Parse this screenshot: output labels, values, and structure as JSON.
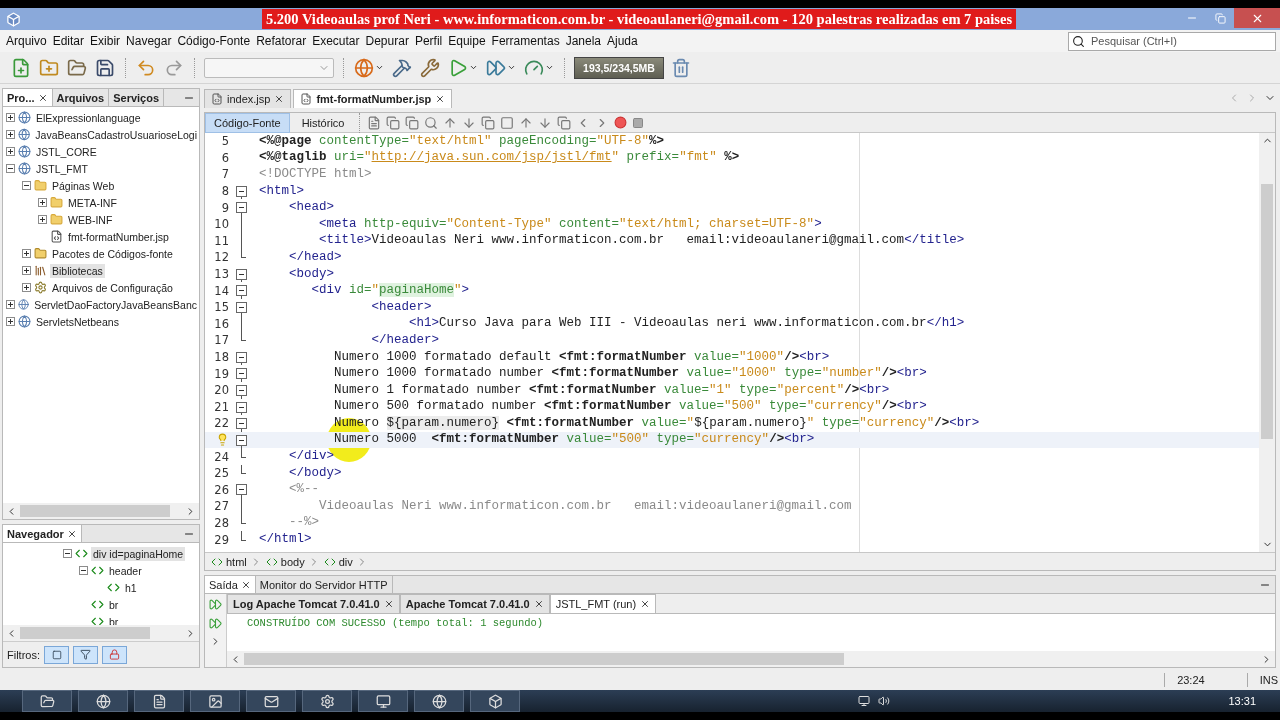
{
  "window": {
    "banner": "5.200 Videoaulas prof Neri - www.informaticon.com.br - videoaulaneri@gmail.com - 120 palestras realizadas em 7 paises"
  },
  "menu": [
    "Arquivo",
    "Editar",
    "Exibir",
    "Navegar",
    "Código-Fonte",
    "Refatorar",
    "Executar",
    "Depurar",
    "Perfil",
    "Equipe",
    "Ferramentas",
    "Janela",
    "Ajuda"
  ],
  "search": {
    "placeholder": "Pesquisar (Ctrl+I)"
  },
  "toolbar": {
    "memory": "193,5/234,5MB"
  },
  "projects_panel": {
    "tabs": [
      {
        "label": "Pro...",
        "selected": true,
        "closable": true
      },
      {
        "label": "Arquivos",
        "selected": false,
        "closable": false
      },
      {
        "label": "Serviços",
        "selected": false,
        "closable": false
      }
    ],
    "tree": [
      {
        "label": "ElExpressionlanguage",
        "kind": "project",
        "expanded": false,
        "selected": false
      },
      {
        "label": "JavaBeansCadastroUsuarioseLogi",
        "kind": "project",
        "expanded": false,
        "selected": false
      },
      {
        "label": "JSTL_CORE",
        "kind": "project",
        "expanded": false,
        "selected": false
      },
      {
        "label": "JSTL_FMT",
        "kind": "project",
        "expanded": true,
        "selected": false,
        "children": [
          {
            "label": "Páginas Web",
            "kind": "web-folder",
            "expanded": true,
            "selected": false,
            "children": [
              {
                "label": "META-INF",
                "kind": "folder",
                "expanded": false,
                "selected": false
              },
              {
                "label": "WEB-INF",
                "kind": "folder",
                "expanded": false,
                "selected": false
              },
              {
                "label": "fmt-formatNumber.jsp",
                "kind": "file",
                "selected": false
              }
            ]
          },
          {
            "label": "Pacotes de Códigos-fonte",
            "kind": "source-folder",
            "expanded": false,
            "selected": false
          },
          {
            "label": "Bibliotecas",
            "kind": "library",
            "expanded": false,
            "selected": true
          },
          {
            "label": "Arquivos de Configuração",
            "kind": "config",
            "expanded": false,
            "selected": false
          }
        ]
      },
      {
        "label": "ServletDaoFactoryJavaBeansBanc",
        "kind": "project",
        "expanded": false,
        "selected": false
      },
      {
        "label": "ServletsNetbeans",
        "kind": "project",
        "expanded": false,
        "selected": false
      }
    ]
  },
  "navigator": {
    "tab": "Navegador",
    "tree": [
      {
        "label": "div id=paginaHome",
        "kind": "element",
        "expanded": true,
        "selected": true,
        "children": [
          {
            "label": "header",
            "kind": "element",
            "expanded": true,
            "selected": false,
            "children": [
              {
                "label": "h1",
                "kind": "element",
                "selected": false
              }
            ]
          },
          {
            "label": "br",
            "kind": "element",
            "selected": false
          },
          {
            "label": "br",
            "kind": "element",
            "selected": false
          }
        ]
      }
    ],
    "filters_label": "Filtros:"
  },
  "editor": {
    "tabs": [
      {
        "label": "index.jsp",
        "selected": false
      },
      {
        "label": "fmt-formatNumber.jsp",
        "selected": true
      }
    ],
    "views": [
      {
        "label": "Código-Fonte",
        "selected": true
      },
      {
        "label": "Histórico",
        "selected": false
      }
    ],
    "lines": [
      {
        "number": "5",
        "kind": "plain",
        "tokens": [
          {
            "kind": "directive",
            "text": "<%@page "
          },
          {
            "kind": "attr",
            "text": "contentType="
          },
          {
            "kind": "value",
            "text": "\"text/html\" "
          },
          {
            "kind": "attr",
            "text": "pageEncoding="
          },
          {
            "kind": "value",
            "text": "\"UTF-8\""
          },
          {
            "kind": "directive",
            "text": "%>"
          }
        ]
      },
      {
        "number": "6",
        "kind": "plain",
        "tokens": [
          {
            "kind": "directive",
            "text": "<%@taglib "
          },
          {
            "kind": "attr",
            "text": "uri="
          },
          {
            "kind": "value",
            "text": "\""
          },
          {
            "kind": "link",
            "text": "http://java.sun.com/jsp/jstl/fmt"
          },
          {
            "kind": "value",
            "text": "\" "
          },
          {
            "kind": "attr",
            "text": "prefix="
          },
          {
            "kind": "value",
            "text": "\"fmt\" "
          },
          {
            "kind": "directive",
            "text": "%>"
          }
        ]
      },
      {
        "number": "7",
        "kind": "plain",
        "tokens": [
          {
            "kind": "comment",
            "text": "<!DOCTYPE html>"
          }
        ]
      },
      {
        "number": "8",
        "kind": "open",
        "tokens": [
          {
            "kind": "tag",
            "text": "<html>"
          }
        ]
      },
      {
        "number": "9",
        "kind": "open",
        "tokens": [
          {
            "kind": "tag",
            "text": "    <head>"
          }
        ]
      },
      {
        "number": "10",
        "kind": "pass",
        "tokens": [
          {
            "kind": "tag",
            "text": "        <meta "
          },
          {
            "kind": "attr",
            "text": "http-equiv="
          },
          {
            "kind": "value",
            "text": "\"Content-Type\" "
          },
          {
            "kind": "attr",
            "text": "content="
          },
          {
            "kind": "value",
            "text": "\"text/html; charset=UTF-8\""
          },
          {
            "kind": "tag",
            "text": ">"
          }
        ]
      },
      {
        "number": "11",
        "kind": "pass",
        "tokens": [
          {
            "kind": "tag",
            "text": "        <title>"
          },
          {
            "kind": "text",
            "text": "Videoaulas Neri www.informaticon.com.br   email:videoaulaneri@gmail.com"
          },
          {
            "kind": "tag",
            "text": "</title>"
          }
        ]
      },
      {
        "number": "12",
        "kind": "end",
        "tokens": [
          {
            "kind": "tag",
            "text": "    </head>"
          }
        ]
      },
      {
        "number": "13",
        "kind": "open",
        "tokens": [
          {
            "kind": "tag",
            "text": "    <body>"
          }
        ]
      },
      {
        "number": "14",
        "kind": "open",
        "tokens": [
          {
            "kind": "tag",
            "text": "       <div "
          },
          {
            "kind": "attr",
            "text": "id="
          },
          {
            "kind": "value",
            "text": "\""
          },
          {
            "kind": "mark",
            "text": "paginaHome"
          },
          {
            "kind": "value",
            "text": "\""
          },
          {
            "kind": "tag",
            "text": ">"
          }
        ]
      },
      {
        "number": "15",
        "kind": "open",
        "tokens": [
          {
            "kind": "tag",
            "text": "               <header>"
          }
        ]
      },
      {
        "number": "16",
        "kind": "pass",
        "tokens": [
          {
            "kind": "tag",
            "text": "                    <h1>"
          },
          {
            "kind": "text",
            "text": "Curso Java para Web III - Videoaulas neri www.informaticon.com.br"
          },
          {
            "kind": "tag",
            "text": "</h1>"
          }
        ]
      },
      {
        "number": "17",
        "kind": "end",
        "tokens": [
          {
            "kind": "tag",
            "text": "               </header>"
          }
        ]
      },
      {
        "number": "18",
        "kind": "open",
        "tokens": [
          {
            "kind": "text",
            "text": "          Numero 1000 formatado default "
          },
          {
            "kind": "jsp",
            "text": "<fmt:formatNumber "
          },
          {
            "kind": "attr",
            "text": "value="
          },
          {
            "kind": "value",
            "text": "\"1000\""
          },
          {
            "kind": "jsp",
            "text": "/>"
          },
          {
            "kind": "tag",
            "text": "<br>"
          }
        ]
      },
      {
        "number": "19",
        "kind": "open",
        "tokens": [
          {
            "kind": "text",
            "text": "          Numero 1000 formatado number "
          },
          {
            "kind": "jsp",
            "text": "<fmt:formatNumber "
          },
          {
            "kind": "attr",
            "text": "value="
          },
          {
            "kind": "value",
            "text": "\"1000\" "
          },
          {
            "kind": "attr",
            "text": "type="
          },
          {
            "kind": "value",
            "text": "\"number\""
          },
          {
            "kind": "jsp",
            "text": "/>"
          },
          {
            "kind": "tag",
            "text": "<br>"
          }
        ]
      },
      {
        "number": "20",
        "kind": "open",
        "tokens": [
          {
            "kind": "text",
            "text": "          Numero 1 formatado number "
          },
          {
            "kind": "jsp",
            "text": "<fmt:formatNumber "
          },
          {
            "kind": "attr",
            "text": "value="
          },
          {
            "kind": "value",
            "text": "\"1\" "
          },
          {
            "kind": "attr",
            "text": "type="
          },
          {
            "kind": "value",
            "text": "\"percent\""
          },
          {
            "kind": "jsp",
            "text": "/>"
          },
          {
            "kind": "tag",
            "text": "<br>"
          }
        ]
      },
      {
        "number": "21",
        "kind": "open",
        "tokens": [
          {
            "kind": "text",
            "text": "          Numero 500 formatado number "
          },
          {
            "kind": "jsp",
            "text": "<fmt:formatNumber "
          },
          {
            "kind": "attr",
            "text": "value="
          },
          {
            "kind": "value",
            "text": "\"500\" "
          },
          {
            "kind": "attr",
            "text": "type="
          },
          {
            "kind": "value",
            "text": "\"currency\""
          },
          {
            "kind": "jsp",
            "text": "/>"
          },
          {
            "kind": "tag",
            "text": "<br>"
          }
        ]
      },
      {
        "number": "22",
        "kind": "open",
        "tokens": [
          {
            "kind": "text",
            "text": "          Numero "
          },
          {
            "kind": "el",
            "text": "${param.numero}"
          },
          {
            "kind": "jsp",
            "text": " <fmt:formatNumber "
          },
          {
            "kind": "attr",
            "text": "value="
          },
          {
            "kind": "value",
            "text": "\""
          },
          {
            "kind": "text",
            "text": "${param.numero}"
          },
          {
            "kind": "value",
            "text": "\" "
          },
          {
            "kind": "attr",
            "text": "type="
          },
          {
            "kind": "value",
            "text": "\"currency\""
          },
          {
            "kind": "jsp",
            "text": "/>"
          },
          {
            "kind": "tag",
            "text": "<br>"
          }
        ]
      },
      {
        "hint": true,
        "current": true,
        "kind": "open",
        "tokens": [
          {
            "kind": "text",
            "text": "          Numero 5000  "
          },
          {
            "kind": "jsp",
            "text": "<fmt:formatNumber "
          },
          {
            "kind": "attr",
            "text": "value="
          },
          {
            "kind": "value",
            "text": "\"500\" "
          },
          {
            "kind": "attr",
            "text": "type="
          },
          {
            "kind": "value",
            "text": "\"currency\""
          },
          {
            "kind": "jsp",
            "text": "/>"
          },
          {
            "kind": "tag",
            "text": "<br>"
          }
        ]
      },
      {
        "number": "24",
        "kind": "end",
        "tokens": [
          {
            "kind": "tag",
            "text": "    </div>"
          }
        ]
      },
      {
        "number": "25",
        "kind": "end",
        "tokens": [
          {
            "kind": "tag",
            "text": "    </body>"
          }
        ]
      },
      {
        "number": "26",
        "kind": "open",
        "tokens": [
          {
            "kind": "comment",
            "text": "    <%--"
          }
        ]
      },
      {
        "number": "27",
        "kind": "pass",
        "tokens": [
          {
            "kind": "comment",
            "text": "        Videoaulas Neri www.informaticon.com.br   email:videoaulaneri@gmail.com"
          }
        ]
      },
      {
        "number": "28",
        "kind": "end",
        "tokens": [
          {
            "kind": "comment",
            "text": "    --%>"
          }
        ]
      },
      {
        "number": "29",
        "kind": "end",
        "tokens": [
          {
            "kind": "tag",
            "text": "</html>"
          }
        ]
      }
    ],
    "breadcrumbs": [
      "html",
      "body",
      "div"
    ]
  },
  "output": {
    "tabs": [
      {
        "label": "Saída",
        "selected": true,
        "closable": true
      },
      {
        "label": "Monitor do Servidor HTTP",
        "selected": false,
        "closable": false
      }
    ],
    "sessions": [
      {
        "label": "Log Apache Tomcat 7.0.41.0",
        "selected": false
      },
      {
        "label": "Apache Tomcat 7.0.41.0",
        "selected": false
      },
      {
        "label": "JSTL_FMT (run)",
        "selected": true
      }
    ],
    "lines": [
      "CONSTRUÍDO COM SUCESSO (tempo total: 1 segundo)"
    ]
  },
  "status_bar": {
    "position": "23:24",
    "mode": "INS"
  },
  "taskbar": {
    "clock": "13:31"
  }
}
